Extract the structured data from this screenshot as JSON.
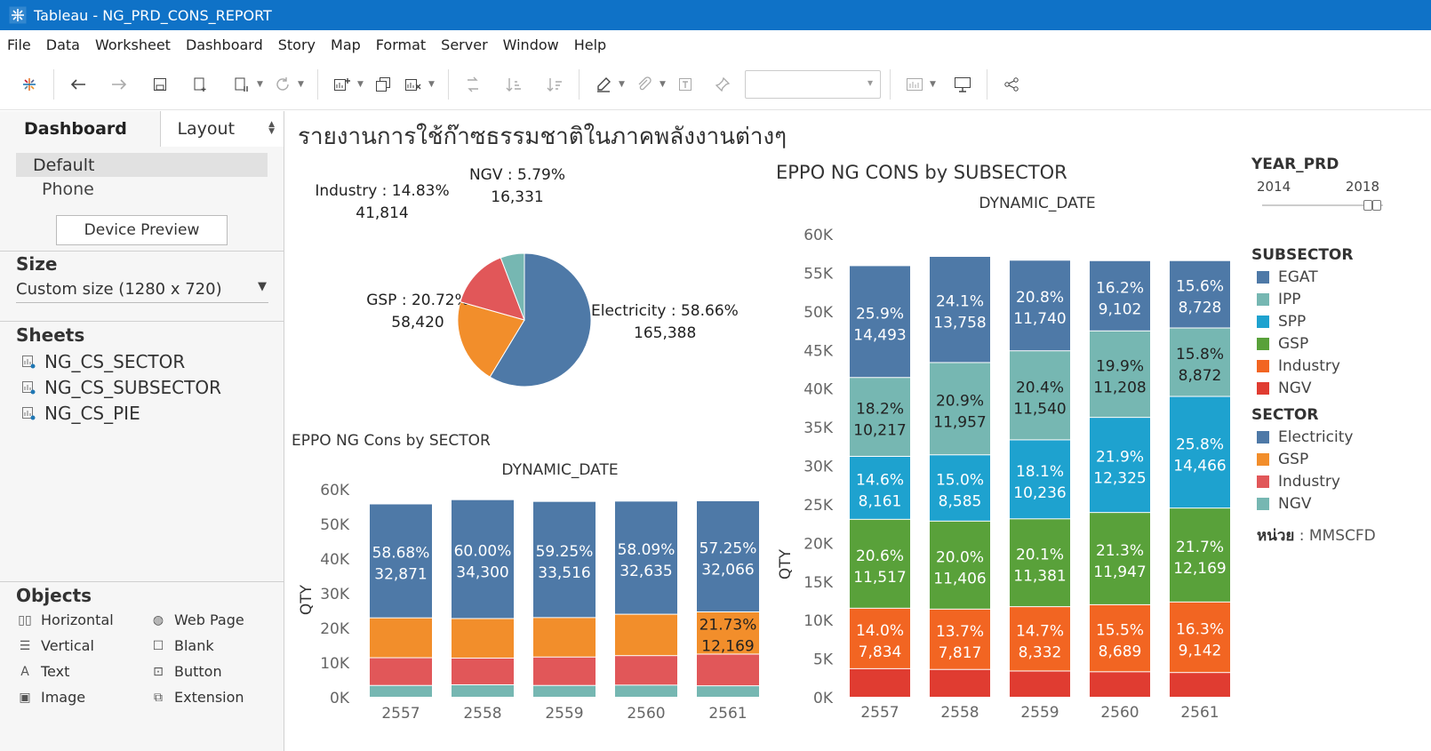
{
  "window": {
    "title": "Tableau - NG_PRD_CONS_REPORT"
  },
  "menu": [
    "File",
    "Data",
    "Worksheet",
    "Dashboard",
    "Story",
    "Map",
    "Format",
    "Server",
    "Window",
    "Help"
  ],
  "left_panel": {
    "tabs": {
      "dashboard": "Dashboard",
      "layout": "Layout"
    },
    "devices": {
      "default": "Default",
      "phone": "Phone",
      "preview_button": "Device Preview"
    },
    "size": {
      "heading": "Size",
      "value": "Custom size (1280 x 720)"
    },
    "sheets": {
      "heading": "Sheets",
      "items": [
        "NG_CS_SECTOR",
        "NG_CS_SUBSECTOR",
        "NG_CS_PIE"
      ]
    },
    "objects": {
      "heading": "Objects",
      "items": [
        {
          "label": "Horizontal",
          "icon": "horizontal-container-icon"
        },
        {
          "label": "Web Page",
          "icon": "globe-icon"
        },
        {
          "label": "Vertical",
          "icon": "vertical-container-icon"
        },
        {
          "label": "Blank",
          "icon": "blank-icon"
        },
        {
          "label": "Text",
          "icon": "text-icon"
        },
        {
          "label": "Button",
          "icon": "button-icon"
        },
        {
          "label": "Image",
          "icon": "image-icon"
        },
        {
          "label": "Extension",
          "icon": "extension-icon"
        }
      ]
    }
  },
  "dashboard": {
    "title": "รายงานการใช้ก๊าซธรรมชาติในภาคพลังงานต่างๆ",
    "filters": {
      "year": {
        "title": "YEAR_PRD",
        "min": "2014",
        "max": "2018"
      },
      "subsector": {
        "title": "SUBSECTOR",
        "items": [
          "EGAT",
          "IPP",
          "SPP",
          "GSP",
          "Industry",
          "NGV"
        ]
      },
      "sector": {
        "title": "SECTOR",
        "items": [
          "Electricity",
          "GSP",
          "Industry",
          "NGV"
        ]
      },
      "unit_label": "หน่วย",
      "unit_value": " : MMSCFD"
    }
  },
  "colors": {
    "EGAT": "#4e79a7",
    "IPP": "#76b7b2",
    "SPP": "#1ea2cf",
    "GSP_sub": "#59a13a",
    "Industry_sub": "#f26522",
    "NGV_sub": "#e03c31",
    "Electricity": "#4e79a7",
    "GSP": "#f28e2b",
    "Industry": "#e15759",
    "NGV": "#76b7b2"
  },
  "chart_data": [
    {
      "type": "pie",
      "slices": [
        {
          "name": "Electricity",
          "label": "Electricity : 58.66%",
          "value": 165388,
          "display": "165,388"
        },
        {
          "name": "GSP",
          "label": "GSP : 20.72%",
          "value": 58420,
          "display": "58,420"
        },
        {
          "name": "Industry",
          "label": "Industry : 14.83%",
          "value": 41814,
          "display": "41,814"
        },
        {
          "name": "NGV",
          "label": "NGV : 5.79%",
          "value": 16331,
          "display": "16,331"
        }
      ]
    },
    {
      "type": "bar",
      "stacked": true,
      "title": "EPPO NG Cons by SECTOR",
      "xlabel": "DYNAMIC_DATE",
      "ylabel": "QTY",
      "ylim": [
        0,
        60000
      ],
      "yticks": [
        "0K",
        "10K",
        "20K",
        "30K",
        "40K",
        "50K",
        "60K"
      ],
      "categories": [
        "2557",
        "2558",
        "2559",
        "2560",
        "2561"
      ],
      "series": [
        {
          "name": "NGV",
          "values": [
            3400,
            3600,
            3400,
            3500,
            3300
          ]
        },
        {
          "name": "Industry",
          "values": [
            8000,
            7700,
            8200,
            8500,
            9142
          ]
        },
        {
          "name": "GSP",
          "values": [
            11500,
            11400,
            11381,
            11947,
            12169
          ],
          "labels": [
            "",
            "",
            "",
            "",
            "21.73%|12,169"
          ]
        },
        {
          "name": "Electricity",
          "values": [
            32871,
            34300,
            33516,
            32635,
            32066
          ],
          "labels": [
            "58.68%|32,871",
            "60.00%|34,300",
            "59.25%|33,516",
            "58.09%|32,635",
            "57.25%|32,066"
          ]
        }
      ]
    },
    {
      "type": "bar",
      "stacked": true,
      "title": "EPPO NG CONS by SUBSECTOR",
      "xlabel": "DYNAMIC_DATE",
      "ylabel": "QTY",
      "ylim": [
        0,
        60000
      ],
      "yticks": [
        "0K",
        "5K",
        "10K",
        "15K",
        "20K",
        "25K",
        "30K",
        "35K",
        "40K",
        "45K",
        "50K",
        "55K",
        "60K"
      ],
      "categories": [
        "2557",
        "2558",
        "2559",
        "2560",
        "2561"
      ],
      "series": [
        {
          "name": "NGV",
          "values": [
            3700,
            3600,
            3400,
            3300,
            3200
          ]
        },
        {
          "name": "Industry",
          "values": [
            7834,
            7817,
            8332,
            8689,
            9142
          ],
          "labels": [
            "14.0%|7,834",
            "13.7%|7,817",
            "14.7%|8,332",
            "15.5%|8,689",
            "16.3%|9,142"
          ]
        },
        {
          "name": "GSP",
          "values": [
            11517,
            11406,
            11381,
            11947,
            12169
          ],
          "labels": [
            "20.6%|11,517",
            "20.0%|11,406",
            "20.1%|11,381",
            "21.3%|11,947",
            "21.7%|12,169"
          ]
        },
        {
          "name": "SPP",
          "values": [
            8161,
            8585,
            10236,
            12325,
            14466
          ],
          "labels": [
            "14.6%|8,161",
            "15.0%|8,585",
            "18.1%|10,236",
            "21.9%|12,325",
            "25.8%|14,466"
          ]
        },
        {
          "name": "IPP",
          "values": [
            10217,
            11957,
            11540,
            11208,
            8872
          ],
          "labels": [
            "18.2%|10,217",
            "20.9%|11,957",
            "20.4%|11,540",
            "19.9%|11,208",
            "15.8%|8,872"
          ]
        },
        {
          "name": "EGAT",
          "values": [
            14493,
            13758,
            11740,
            9102,
            8728
          ],
          "labels": [
            "25.9%|14,493",
            "24.1%|13,758",
            "20.8%|11,740",
            "16.2%|9,102",
            "15.6%|8,728"
          ]
        }
      ]
    }
  ]
}
